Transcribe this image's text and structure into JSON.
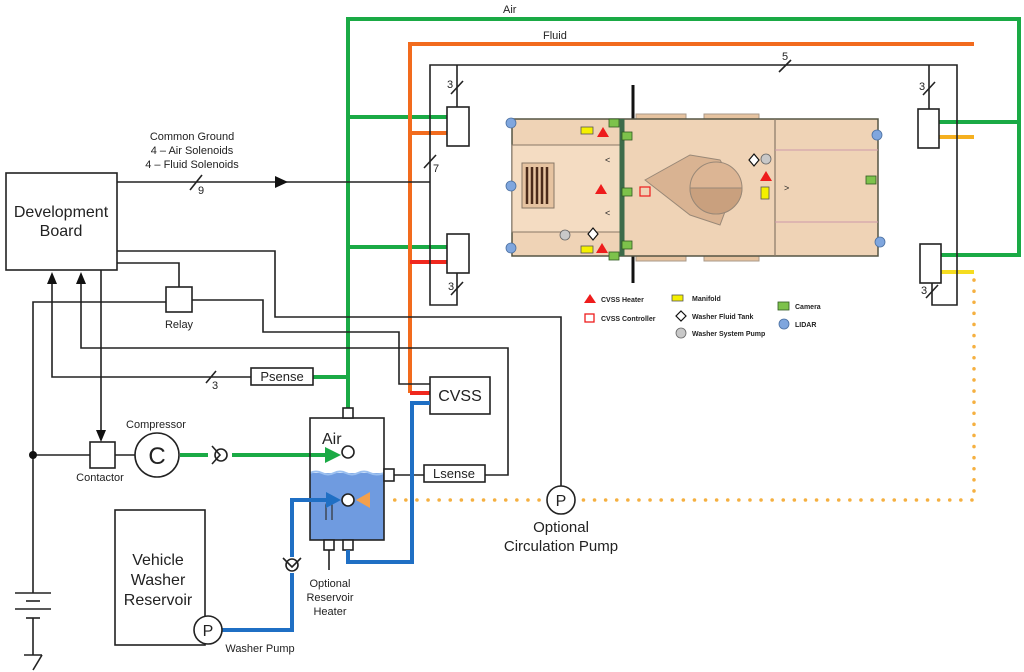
{
  "labels": {
    "air_line": "Air",
    "fluid_line": "Fluid",
    "bus_line": [
      "Common Ground",
      "4 – Air Solenoids",
      "4 – Fluid Solenoids"
    ],
    "development_board": [
      "Development",
      "Board"
    ],
    "relay": "Relay",
    "psense": "Psense",
    "cvss": "CVSS",
    "compressor": "Compressor",
    "compressor_symbol": "C",
    "contactor": "Contactor",
    "tank_air": "Air",
    "lsense": "Lsense",
    "vehicle_reservoir": [
      "Vehicle",
      "Washer",
      "Reservoir"
    ],
    "washer_pump": "Washer Pump",
    "pump_symbol": "P",
    "reservoir_heater": [
      "Optional",
      "Reservoir",
      "Heater"
    ],
    "circulation_pump": [
      "Optional",
      "Circulation Pump"
    ]
  },
  "wire_counts": {
    "main_bus": "9",
    "left_bus": "7",
    "top_bus": "5",
    "solenoid_front_left": "3",
    "solenoid_rear_left": "3",
    "solenoid_front_right": "3",
    "solenoid_rear_right": "3",
    "psense": "3"
  },
  "legend": [
    {
      "label": "CVSS Heater",
      "icon": "red-triangle"
    },
    {
      "label": "CVSS Controller",
      "icon": "red-square-outline"
    },
    {
      "label": "Manifold",
      "icon": "yellow-rectangle"
    },
    {
      "label": "Washer Fluid Tank",
      "icon": "diamond"
    },
    {
      "label": "Washer System Pump",
      "icon": "grey-circle"
    },
    {
      "label": "Camera",
      "icon": "green-square"
    },
    {
      "label": "LIDAR",
      "icon": "blue-circle"
    }
  ],
  "colors": {
    "air": "#1aaa45",
    "fluid_top": "#f26b1d",
    "fluid_left": "#f0281e",
    "fluid_right": "#f5c518",
    "water": "#1f6fc4",
    "tank_fluid": "#6f9be0",
    "circulation_dotted": "#f5a04a",
    "vehicle": "#efd3b6"
  }
}
